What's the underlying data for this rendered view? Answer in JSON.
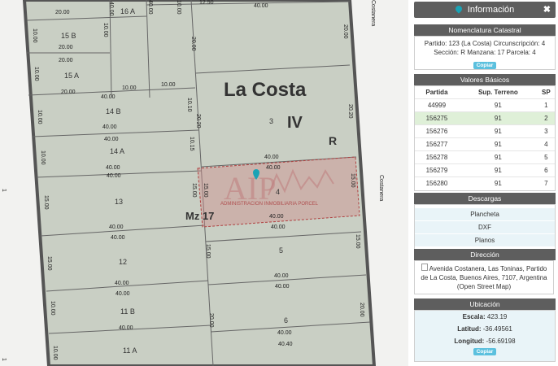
{
  "map": {
    "locality": "La Costa",
    "circ": "IV",
    "section": "R",
    "manzana": "Mz 17",
    "street_right": "Costanera",
    "watermark": "ADMINISTRACION INMOBILIARIA PORCEL",
    "lots": [
      "16 A",
      "15 B",
      "15 A",
      "14 B",
      "14 A",
      "13",
      "12",
      "11 B",
      "11 A",
      "3",
      "4",
      "5",
      "6"
    ],
    "dims": {
      "d2000": "20.00",
      "d1000": "10.00",
      "d4000": "40.00",
      "d1500": "15.00",
      "d1250": "12.50",
      "d2020": "20.20",
      "d1010": "10.10",
      "d1015": "10.15",
      "d4040": "40.40"
    },
    "edge_marks": [
      "1",
      "1"
    ]
  },
  "panel": {
    "title": "Información",
    "nomenclatura": {
      "header": "Nomenclatura Catastral",
      "line1": "Partido: 123 (La Costa) Circunscripción: 4",
      "line2": "Sección: R Manzana: 17 Parcela: 4",
      "copy": "Copiar"
    },
    "valores": {
      "header": "Valores Básicos",
      "columns": [
        "Partida",
        "Sup. Terreno",
        "SP"
      ],
      "rows": [
        [
          "44999",
          "91",
          "1"
        ],
        [
          "156275",
          "91",
          "2"
        ],
        [
          "156276",
          "91",
          "3"
        ],
        [
          "156277",
          "91",
          "4"
        ],
        [
          "156278",
          "91",
          "5"
        ],
        [
          "156279",
          "91",
          "6"
        ],
        [
          "156280",
          "91",
          "7"
        ]
      ]
    },
    "descargas": {
      "header": "Descargas",
      "items": [
        "Plancheta",
        "DXF",
        "Planos"
      ]
    },
    "direccion": {
      "header": "Dirección",
      "text": "Avenida Costanera, Las Toninas, Partido de La Costa, Buenos Aires, 7107, Argentina (Open Street Map)"
    },
    "ubicacion": {
      "header": "Ubicación",
      "escala_label": "Escala:",
      "escala": "423.19",
      "latitud_label": "Latitud:",
      "latitud": "-36.49561",
      "longitud_label": "Longitud:",
      "longitud": "-56.69198",
      "copy": "Copiar"
    }
  },
  "colors": {
    "parcel": "#c9cfc4",
    "highlight": "#cf8d8d",
    "header": "#5e5e5e",
    "selected_row": "#dff0d8",
    "button": "#5bc0de",
    "marker": "#1aa3b5"
  },
  "icons": [
    "location-pin-icon",
    "close-icon",
    "map-marker-icon",
    "broken-image-icon"
  ]
}
